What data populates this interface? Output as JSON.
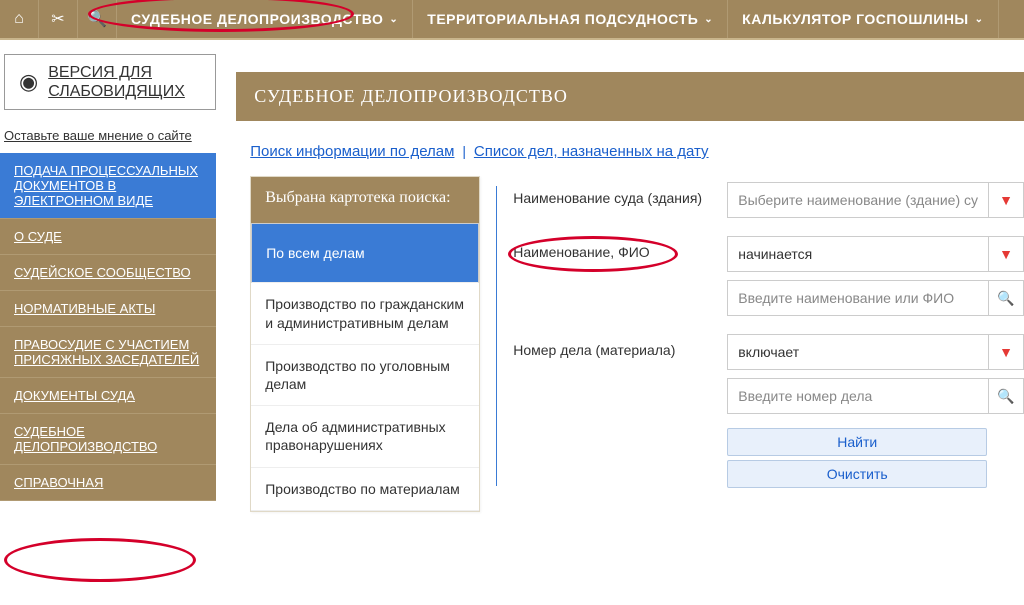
{
  "topnav": {
    "items": [
      {
        "label": "СУДЕБНОЕ ДЕЛОПРОИЗВОДСТВО"
      },
      {
        "label": "ТЕРРИТОРИАЛЬНАЯ ПОДСУДНОСТЬ"
      },
      {
        "label": "КАЛЬКУЛЯТОР ГОСПОШЛИНЫ"
      }
    ]
  },
  "accessibility": {
    "label": "ВЕРСИЯ ДЛЯ СЛАБОВИДЯЩИХ"
  },
  "feedback": {
    "label": "Оставьте ваше мнение о сайте"
  },
  "sidebar": {
    "items": [
      {
        "label": "ПОДАЧА ПРОЦЕССУАЛЬНЫХ ДОКУМЕНТОВ В ЭЛЕКТРОННОМ ВИДЕ",
        "active": true
      },
      {
        "label": "О СУДЕ"
      },
      {
        "label": "СУДЕЙСКОЕ СООБЩЕСТВО"
      },
      {
        "label": "НОРМАТИВНЫЕ АКТЫ"
      },
      {
        "label": "ПРАВОСУДИЕ С УЧАСТИЕМ ПРИСЯЖНЫХ ЗАСЕДАТЕЛЕЙ"
      },
      {
        "label": "ДОКУМЕНТЫ СУДА"
      },
      {
        "label": "СУДЕБНОЕ ДЕЛОПРОИЗВОДСТВО"
      },
      {
        "label": "СПРАВОЧНАЯ"
      }
    ]
  },
  "content": {
    "title": "СУДЕБНОЕ ДЕЛОПРОИЗВОДСТВО",
    "sublinks": {
      "first": "Поиск информации по делам",
      "second": "Список дел, назначенных на дату"
    }
  },
  "card": {
    "head": "Выбрана картотека поиска:",
    "items": [
      {
        "label": "По всем делам",
        "selected": true
      },
      {
        "label": "Производство по гражданским и административным делам"
      },
      {
        "label": "Производство по уголовным делам"
      },
      {
        "label": "Дела об административных правонарушениях"
      },
      {
        "label": "Производство по материалам"
      }
    ]
  },
  "form": {
    "rows": [
      {
        "label": "Наименование суда (здания)",
        "select": {
          "placeholder": "Выберите наименование (здание) су"
        }
      },
      {
        "label": "Наименование, ФИО",
        "select": {
          "value": "начинается"
        },
        "input": {
          "placeholder": "Введите наименование или ФИО"
        }
      },
      {
        "label": "Номер дела (материала)",
        "select": {
          "value": "включает"
        },
        "input": {
          "placeholder": "Введите номер дела"
        }
      }
    ],
    "actions": {
      "find": "Найти",
      "clear": "Очистить"
    }
  }
}
